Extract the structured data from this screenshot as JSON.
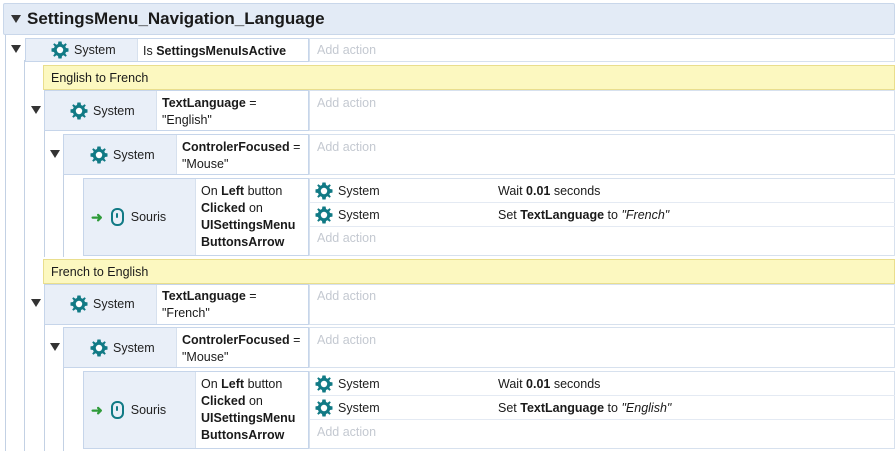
{
  "group": {
    "title": "SettingsMenu_Navigation_Language"
  },
  "root_event": {
    "condition": {
      "object": "System",
      "prefix": "Is",
      "name": "SettingsMenuIsActive"
    },
    "add_action": "Add action"
  },
  "blocks": [
    {
      "comment": "English to French",
      "lang_cond": {
        "object": "System",
        "var": "TextLanguage",
        "op": "=",
        "value": "\"English\""
      },
      "focus_cond": {
        "object": "System",
        "var": "ControlerFocused",
        "op": "=",
        "value": "\"Mouse\""
      },
      "trigger": {
        "object": "Souris",
        "line1_pre": "On",
        "line1_bold": "Left",
        "line1_post": "button",
        "line2_bold": "Clicked",
        "line2_post": "on",
        "line3": "UISettingsMenu",
        "line4": "ButtonsArrow"
      },
      "actions": [
        {
          "object": "System",
          "pre": "Wait",
          "bold": "0.01",
          "post": "seconds"
        },
        {
          "object": "System",
          "pre": "Set",
          "bold": "TextLanguage",
          "mid": "to",
          "italic": "\"French\""
        }
      ],
      "add_action": "Add action"
    },
    {
      "comment": "French to English",
      "lang_cond": {
        "object": "System",
        "var": "TextLanguage",
        "op": "=",
        "value": "\"French\""
      },
      "focus_cond": {
        "object": "System",
        "var": "ControlerFocused",
        "op": "=",
        "value": "\"Mouse\""
      },
      "trigger": {
        "object": "Souris",
        "line1_pre": "On",
        "line1_bold": "Left",
        "line1_post": "button",
        "line2_bold": "Clicked",
        "line2_post": "on",
        "line3": "UISettingsMenu",
        "line4": "ButtonsArrow"
      },
      "actions": [
        {
          "object": "System",
          "pre": "Wait",
          "bold": "0.01",
          "post": "seconds"
        },
        {
          "object": "System",
          "pre": "Set",
          "bold": "TextLanguage",
          "mid": "to",
          "italic": "\"English\""
        }
      ],
      "add_action": "Add action"
    }
  ],
  "icons": {
    "system": "gear-icon",
    "souris": "mouse-icon",
    "trigger": "green-arrow-icon",
    "toggle": "collapse-triangle-icon"
  },
  "colors": {
    "gear": "#117a85",
    "header_bg": "#e3ebf6",
    "comment_bg": "#fcf8c0",
    "add_action": "#c4c9d1"
  }
}
